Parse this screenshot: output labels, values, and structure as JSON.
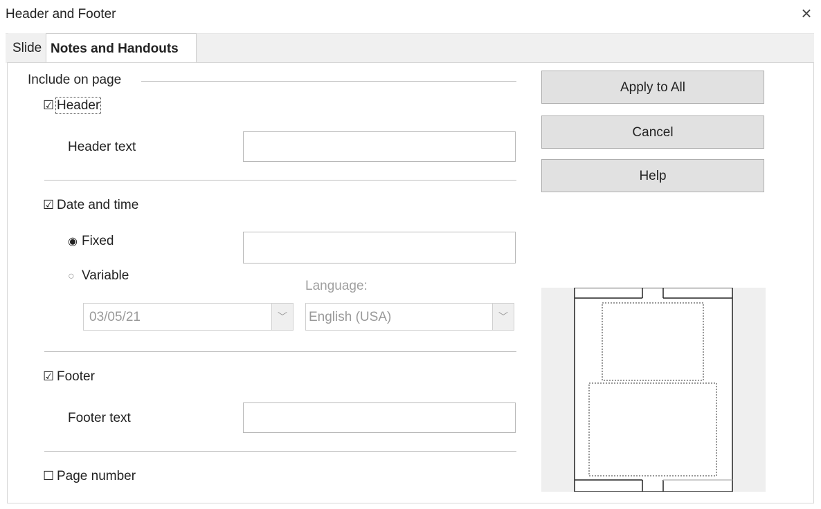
{
  "window": {
    "title": "Header and Footer",
    "close_glyph": "×"
  },
  "tabs": [
    {
      "label": "Slide",
      "active": false
    },
    {
      "label": "Notes and Handouts",
      "active": true
    }
  ],
  "section": {
    "title": "Include on page"
  },
  "header": {
    "checkbox_label": "Header",
    "checked": true,
    "field_label": "Header text",
    "value": ""
  },
  "date_time": {
    "checkbox_label": "Date and time",
    "checked": true,
    "fixed_label": "Fixed",
    "fixed_selected": true,
    "fixed_value": "",
    "variable_label": "Variable",
    "variable_selected": false,
    "format_value": "03/05/21",
    "language_label": "Language:",
    "language_value": "English (USA)"
  },
  "footer": {
    "checkbox_label": "Footer",
    "checked": true,
    "field_label": "Footer text",
    "value": ""
  },
  "page_number": {
    "checkbox_label": "Page number",
    "checked": false
  },
  "buttons": {
    "apply_all": "Apply to All",
    "cancel": "Cancel",
    "help": "Help"
  },
  "glyphs": {
    "checkbox_checked": "☑",
    "checkbox_unchecked": "☐",
    "radio_on": "◉",
    "radio_off": "○",
    "chevron": "﹀"
  }
}
